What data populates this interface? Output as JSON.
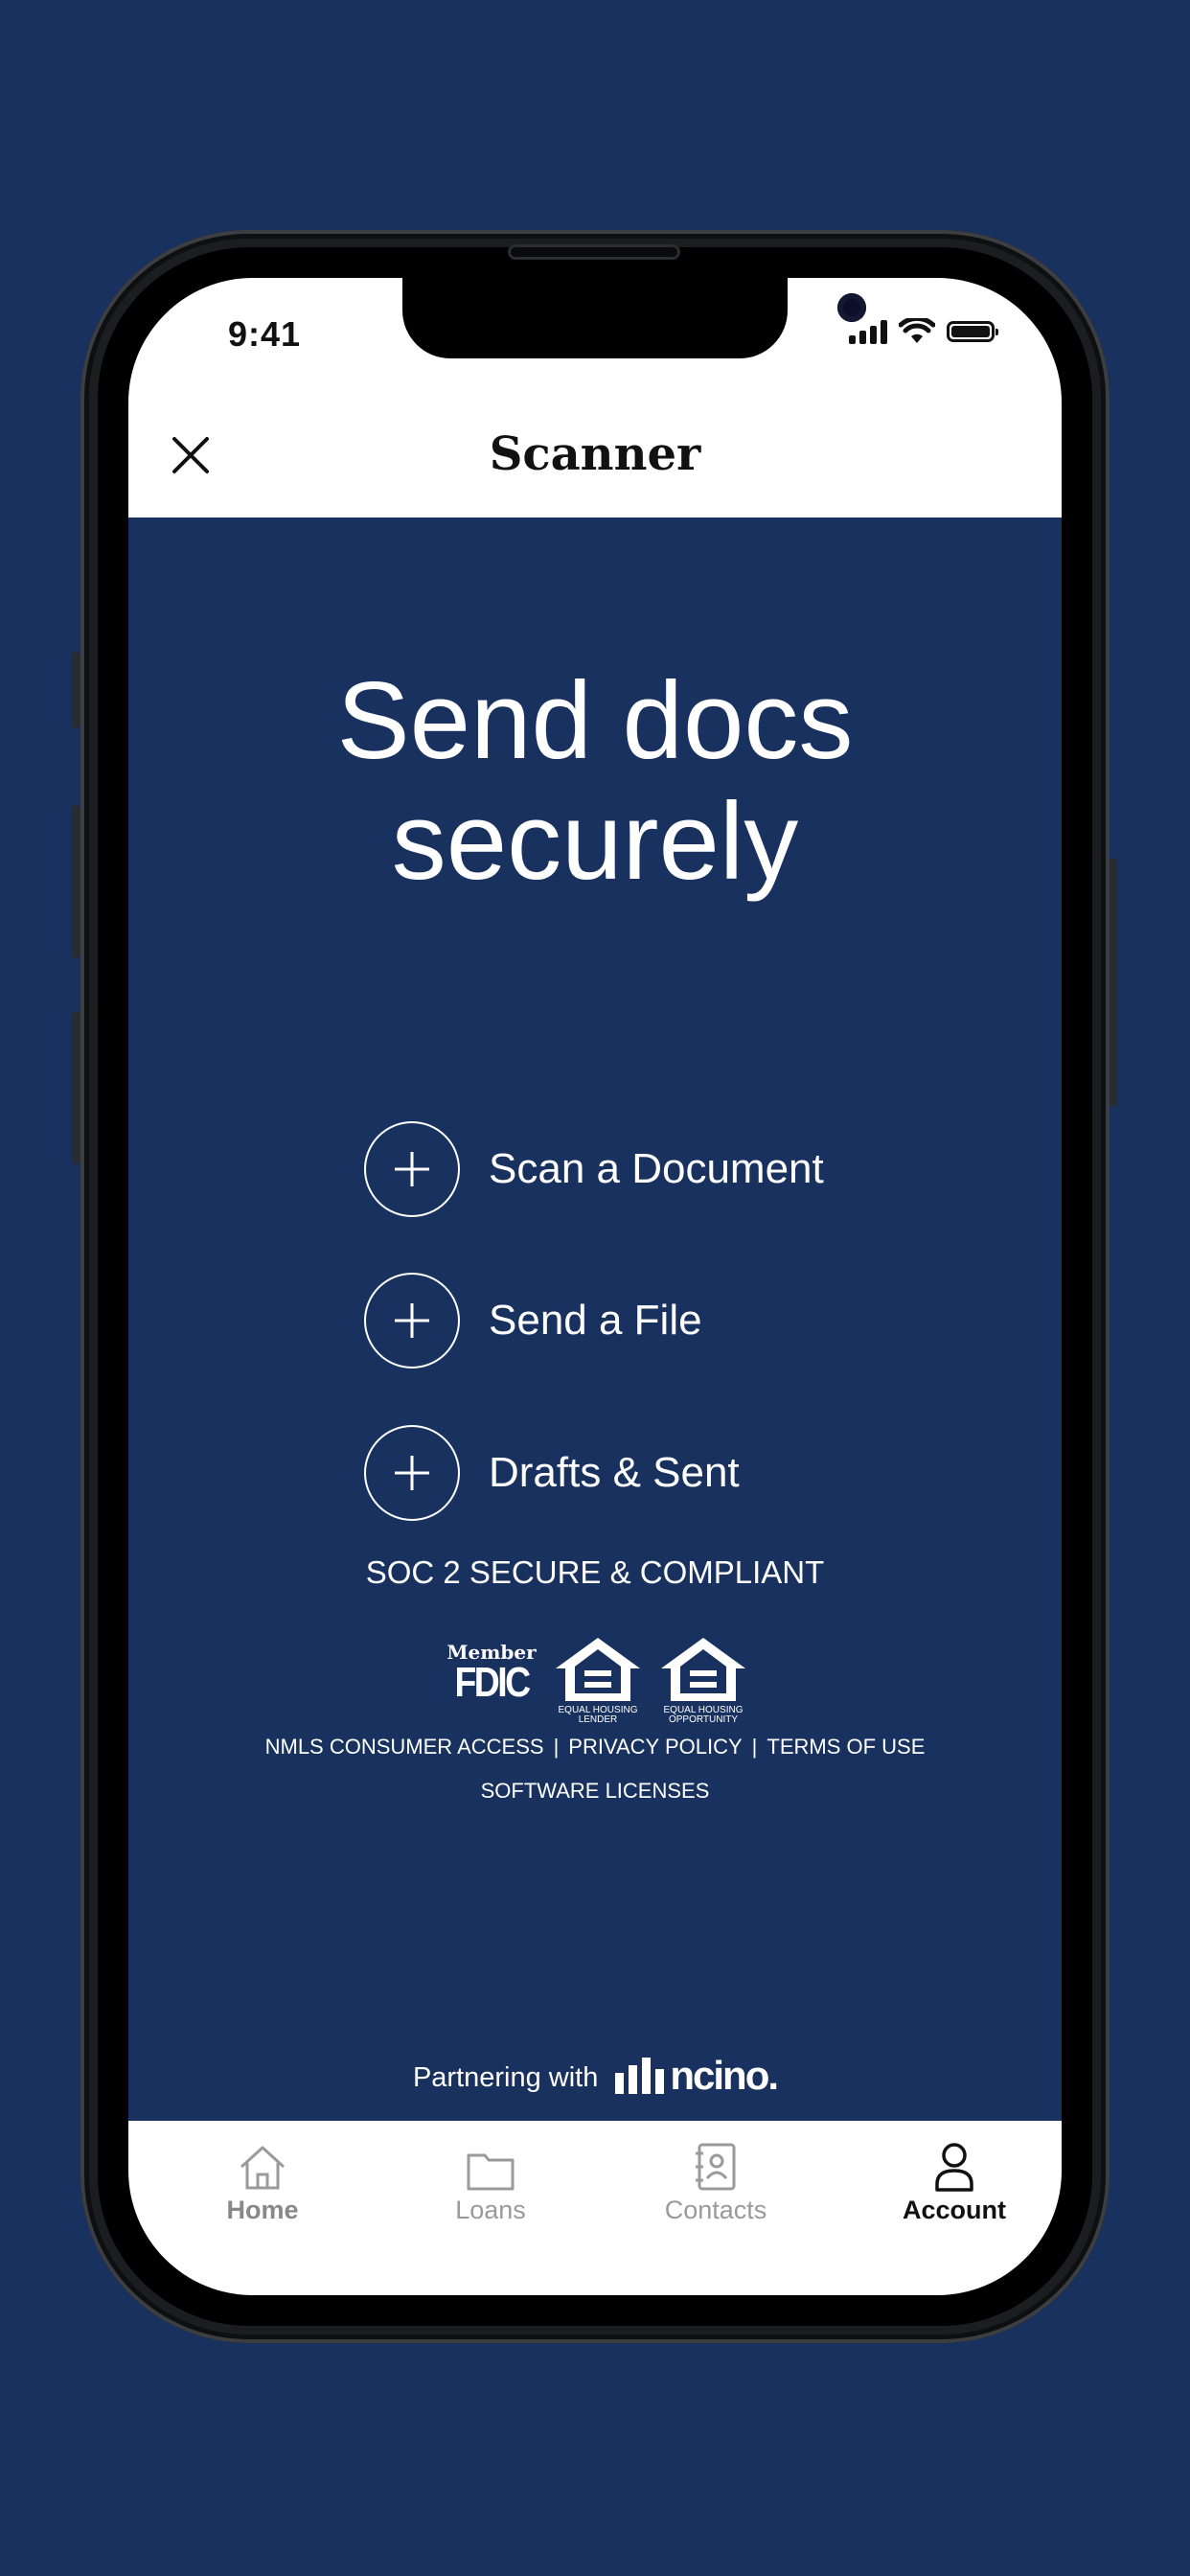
{
  "status_bar": {
    "time": "9:41"
  },
  "nav": {
    "title": "Scanner",
    "close_icon": "close-icon"
  },
  "headline": {
    "line1": "Send docs",
    "line2": "securely"
  },
  "actions": [
    {
      "label": "Scan a Document",
      "icon": "plus-circle-icon"
    },
    {
      "label": "Send a File",
      "icon": "plus-circle-icon"
    },
    {
      "label": "Drafts & Sent",
      "icon": "plus-circle-icon"
    }
  ],
  "compliance": {
    "soc_text": "SOC 2 SECURE & COMPLIANT",
    "fdic": {
      "member": "Member",
      "name": "FDIC"
    },
    "equal_housing_lender": "EQUAL HOUSING LENDER",
    "equal_housing_opportunity": "EQUAL HOUSING OPPORTUNITY"
  },
  "footer_links": {
    "nmls": "NMLS CONSUMER ACCESS",
    "privacy": "PRIVACY POLICY",
    "terms": "TERMS OF USE",
    "software": "SOFTWARE LICENSES",
    "separator": "|"
  },
  "partner": {
    "prefix": "Partnering with",
    "brand": "ncino."
  },
  "tabbar": {
    "tabs": [
      {
        "label": "Home",
        "icon": "home-icon",
        "active": false
      },
      {
        "label": "Loans",
        "icon": "folder-icon",
        "active": false
      },
      {
        "label": "Contacts",
        "icon": "contacts-book-icon",
        "active": false
      },
      {
        "label": "Account",
        "icon": "person-icon",
        "active": true
      }
    ]
  },
  "colors": {
    "background": "#18315e",
    "white": "#ffffff",
    "inactive_tab": "#9a9a9a"
  }
}
